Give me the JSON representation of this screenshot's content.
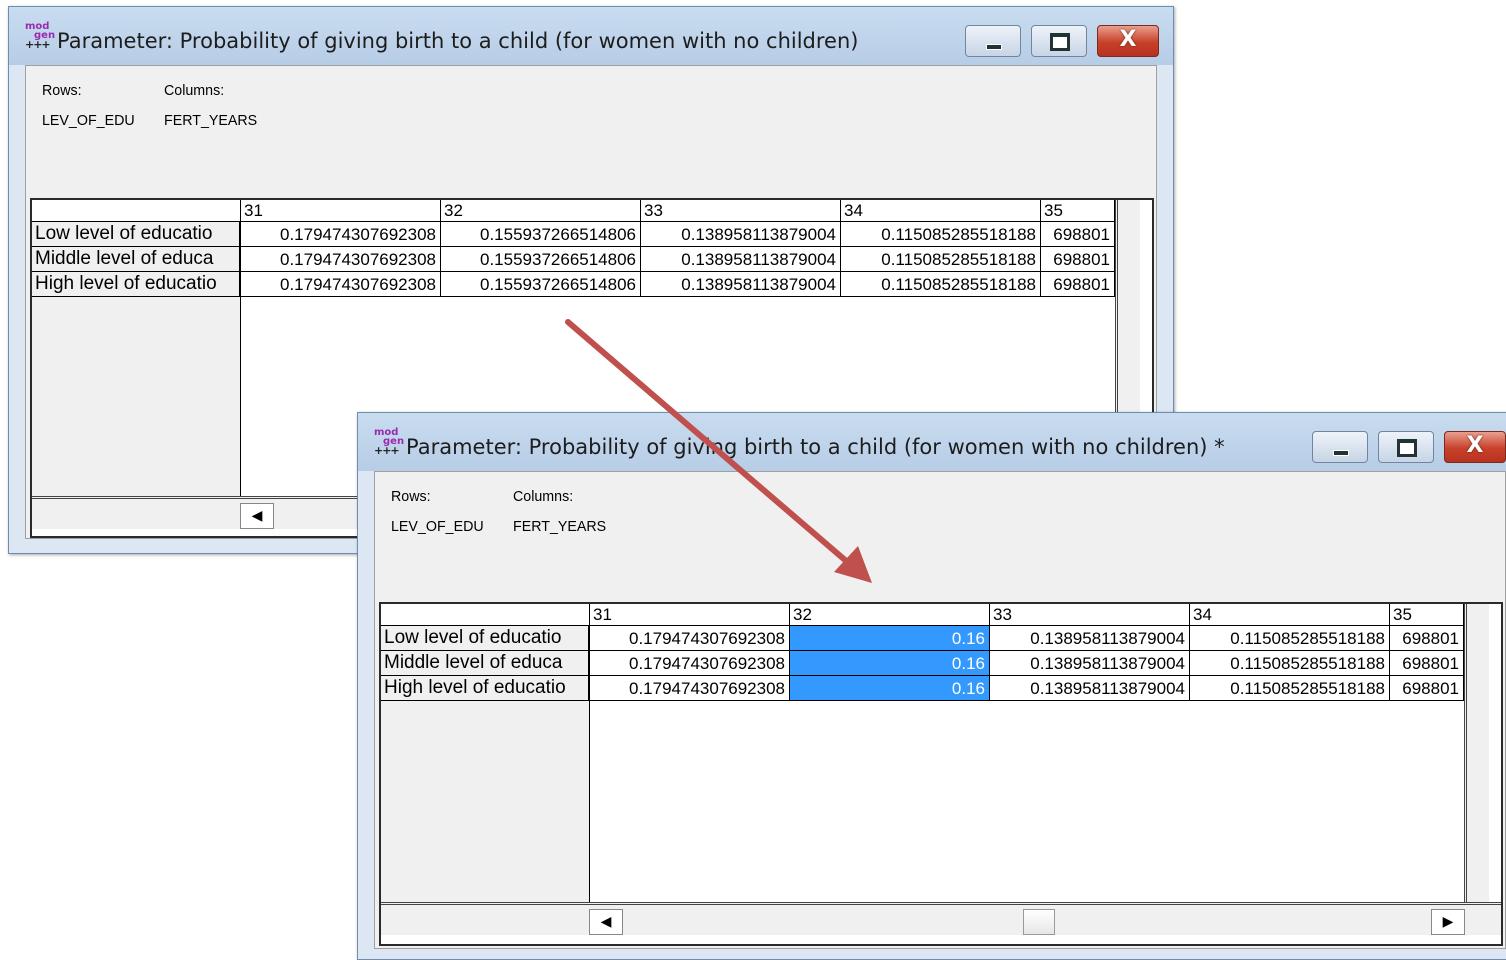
{
  "windows": [
    {
      "title": "Parameter: Probability of giving birth to a child (for women with no children)",
      "icon": "modgen-app-icon",
      "icon_text": [
        "mod",
        "gen",
        "+++"
      ],
      "dims": {
        "rows_label": "Rows:",
        "columns_label": "Columns:",
        "rows_value": "LEV_OF_EDU",
        "columns_value": "FERT_YEARS"
      },
      "columns": [
        "31",
        "32",
        "33",
        "34",
        "35"
      ],
      "rows": [
        {
          "label": "Low level of educatio",
          "values": [
            "0.179474307692308",
            "0.155937266514806",
            "0.138958113879004",
            "0.115085285518188",
            "698801"
          ]
        },
        {
          "label": "Middle level of educa",
          "values": [
            "0.179474307692308",
            "0.155937266514806",
            "0.138958113879004",
            "0.115085285518188",
            "698801"
          ]
        },
        {
          "label": "High level of educatio",
          "values": [
            "0.179474307692308",
            "0.155937266514806",
            "0.138958113879004",
            "0.115085285518188",
            "698801"
          ]
        }
      ]
    },
    {
      "title": "Parameter: Probability of giving birth to a child (for women with no children) *",
      "icon": "modgen-app-icon",
      "icon_text": [
        "mod",
        "gen",
        "+++"
      ],
      "dims": {
        "rows_label": "Rows:",
        "columns_label": "Columns:",
        "rows_value": "LEV_OF_EDU",
        "columns_value": "FERT_YEARS"
      },
      "columns": [
        "31",
        "32",
        "33",
        "34",
        "35"
      ],
      "selected_column": "32",
      "rows": [
        {
          "label": "Low level of educatio",
          "values": [
            "0.179474307692308",
            "0.16",
            "0.138958113879004",
            "0.115085285518188",
            "698801"
          ]
        },
        {
          "label": "Middle level of educa",
          "values": [
            "0.179474307692308",
            "0.16",
            "0.138958113879004",
            "0.115085285518188",
            "698801"
          ]
        },
        {
          "label": "High level of educatio",
          "values": [
            "0.179474307692308",
            "0.16",
            "0.138958113879004",
            "0.115085285518188",
            "698801"
          ]
        }
      ]
    }
  ],
  "controls": {
    "minimize": "minimize-icon",
    "maximize": "maximize-icon",
    "close": "close-icon",
    "close_glyph": "X",
    "scroll_left": "◀",
    "scroll_right": "▶"
  },
  "colors": {
    "selection": "#3399ff",
    "arrow": "#c0504d",
    "close_button": "#c7402a"
  }
}
